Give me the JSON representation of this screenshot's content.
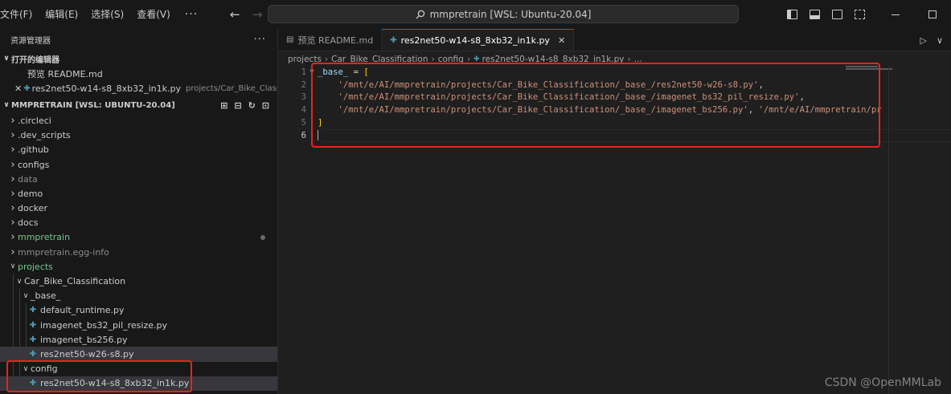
{
  "menu": {
    "items": [
      "文件(F)",
      "编辑(E)",
      "选择(S)",
      "查看(V)"
    ],
    "more": "···"
  },
  "command_center": {
    "text": "mmpretrain [WSL: Ubuntu-20.04]"
  },
  "sidebar": {
    "title": "资源管理器",
    "more": "···",
    "open_editors": {
      "title": "打开的编辑器",
      "items": [
        {
          "icon": "markdown-preview-icon",
          "label": "预览 README.md",
          "desc": ""
        },
        {
          "icon": "python-file-icon",
          "label": "res2net50-w14-s8_8xb32_in1k.py",
          "desc": "projects/Car_Bike_Classificati..."
        }
      ]
    },
    "project": {
      "title": "MMPRETRAIN [WSL: UBUNTU-20.04]"
    },
    "tree": [
      {
        "label": ".circleci",
        "type": "folder",
        "expanded": false,
        "depth": 0
      },
      {
        "label": ".dev_scripts",
        "type": "folder",
        "expanded": false,
        "depth": 0
      },
      {
        "label": ".github",
        "type": "folder",
        "expanded": false,
        "depth": 0
      },
      {
        "label": "configs",
        "type": "folder",
        "expanded": false,
        "depth": 0
      },
      {
        "label": "data",
        "type": "folder",
        "expanded": false,
        "depth": 0
      },
      {
        "label": "demo",
        "type": "folder",
        "expanded": false,
        "depth": 0
      },
      {
        "label": "docker",
        "type": "folder",
        "expanded": false,
        "depth": 0
      },
      {
        "label": "docs",
        "type": "folder",
        "expanded": false,
        "depth": 0
      },
      {
        "label": "mmpretrain",
        "type": "folder",
        "expanded": false,
        "depth": 0
      },
      {
        "label": "mmpretrain.egg-info",
        "type": "folder",
        "expanded": false,
        "depth": 0
      },
      {
        "label": "projects",
        "type": "folder",
        "expanded": true,
        "depth": 0
      },
      {
        "label": "Car_Bike_Classification",
        "type": "folder",
        "expanded": true,
        "depth": 1
      },
      {
        "label": "_base_",
        "type": "folder",
        "expanded": true,
        "depth": 2
      },
      {
        "label": "default_runtime.py",
        "type": "file",
        "depth": 3
      },
      {
        "label": "imagenet_bs32_pil_resize.py",
        "type": "file",
        "depth": 3
      },
      {
        "label": "imagenet_bs256.py",
        "type": "file",
        "depth": 3
      },
      {
        "label": "res2net50-w26-s8.py",
        "type": "file",
        "depth": 3
      },
      {
        "label": "config",
        "type": "folder",
        "expanded": true,
        "depth": 2
      },
      {
        "label": "res2net50-w14-s8_8xb32_in1k.py",
        "type": "file",
        "depth": 3
      }
    ]
  },
  "tabs": [
    {
      "label": "预览 README.md",
      "icon": "markdown-preview-icon",
      "active": false
    },
    {
      "label": "res2net50-w14-s8_8xb32_in1k.py",
      "icon": "python-file-icon",
      "active": true
    }
  ],
  "breadcrumb": [
    "projects",
    "Car_Bike_Classification",
    "config",
    "res2net50-w14-s8_8xb32_in1k.py",
    "..."
  ],
  "code": {
    "line_numbers": [
      "1",
      "2",
      "3",
      "4",
      "5",
      "6"
    ],
    "line1_var": "_base_",
    "line1_op": " = ",
    "line1_bracket": "[",
    "line2": "'/mnt/e/AI/mmpretrain/projects/Car_Bike_Classification/_base_/res2net50-w26-s8.py'",
    "line3": "'/mnt/e/AI/mmpretrain/projects/Car_Bike_Classification/_base_/imagenet_bs32_pil_resize.py'",
    "line4a": "'/mnt/e/AI/mmpretrain/projects/Car_Bike_Classification/_base_/imagenet_bs256.py'",
    "line4b": "'/mnt/e/AI/mmpretrain/pr",
    "comma": ",",
    "line5": "]"
  },
  "watermark": "CSDN @OpenMMLab",
  "colors": {
    "highlight_box": "#e8231b",
    "accent": "#0078d4",
    "string": "#ce9178",
    "variable": "#9cdcfe",
    "bracket": "#ffd700",
    "modified_folder": "#73c991"
  }
}
